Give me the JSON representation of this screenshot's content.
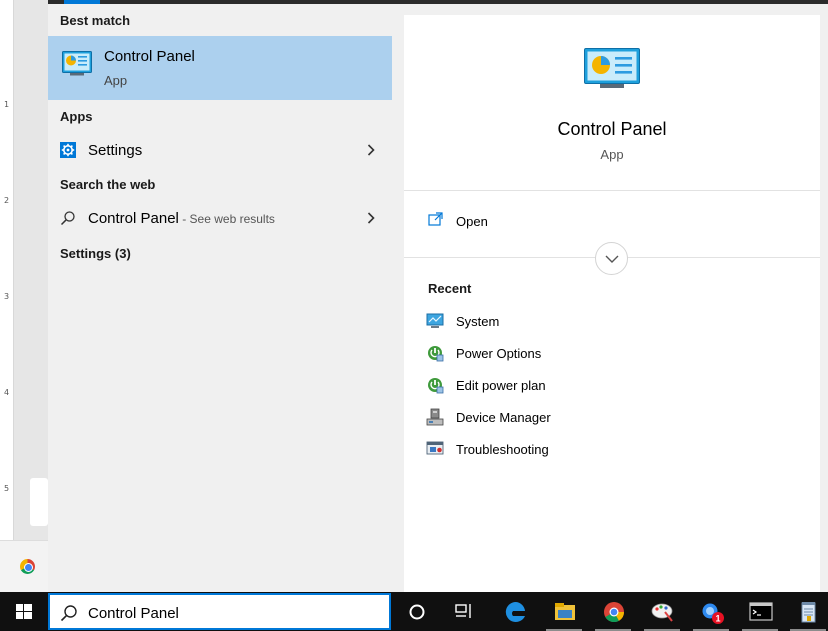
{
  "background": {
    "ruler_numbers": [
      "1",
      "2",
      "3",
      "4",
      "5"
    ]
  },
  "results": {
    "best_match_header": "Best match",
    "best_match": {
      "title": "Control Panel",
      "subtitle": "App",
      "icon": "control-panel-icon"
    },
    "apps_header": "Apps",
    "apps": [
      {
        "label": "Settings",
        "icon": "gear-icon"
      }
    ],
    "web_header": "Search the web",
    "web": [
      {
        "label": "Control Panel",
        "suffix": " - See web results",
        "icon": "search-icon"
      }
    ],
    "settings_header": "Settings (3)"
  },
  "preview": {
    "title": "Control Panel",
    "subtitle": "App",
    "open_label": "Open",
    "recent_header": "Recent",
    "recent": [
      {
        "label": "System",
        "icon": "system-icon"
      },
      {
        "label": "Power Options",
        "icon": "power-options-icon"
      },
      {
        "label": "Edit power plan",
        "icon": "power-plan-icon"
      },
      {
        "label": "Device Manager",
        "icon": "device-manager-icon"
      },
      {
        "label": "Troubleshooting",
        "icon": "troubleshooting-icon"
      }
    ]
  },
  "taskbar": {
    "search_value": "Control Panel",
    "notification_badge": "1",
    "icons": [
      "windows-logo-icon",
      "cortana-icon",
      "task-view-icon",
      "edge-icon",
      "file-explorer-icon",
      "chrome-icon",
      "paint-icon",
      "messenger-icon",
      "command-prompt-icon",
      "notepad-icon"
    ]
  },
  "colors": {
    "accent": "#0078d7",
    "selected_bg": "#acd0ee",
    "menu_bg": "#f0f0f0",
    "taskbar_bg": "#101010",
    "badge": "#e81123"
  }
}
